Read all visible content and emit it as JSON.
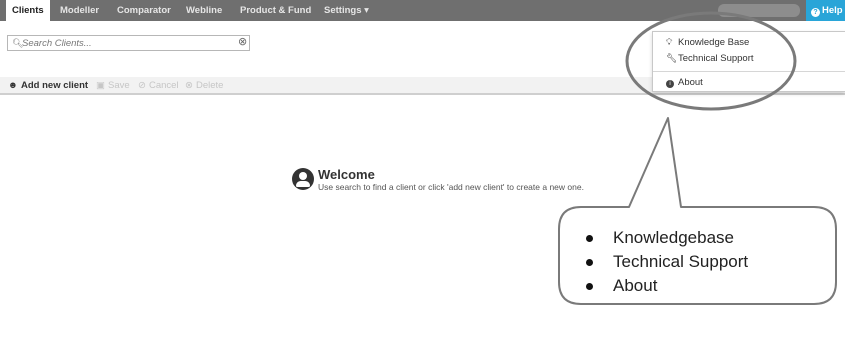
{
  "nav": {
    "tabs": [
      {
        "label": "Clients",
        "active": true
      },
      {
        "label": "Modeller"
      },
      {
        "label": "Comparator"
      },
      {
        "label": "Webline"
      },
      {
        "label": "Product & Fund"
      },
      {
        "label": "Settings ▾"
      }
    ],
    "help_label": "Help",
    "help_color": "#29a5d8"
  },
  "search": {
    "placeholder": "Search Clients...",
    "icon": "search-icon",
    "clear_icon": "clear-icon"
  },
  "toolbar": {
    "add_label": "Add new client",
    "save_label": "Save",
    "cancel_label": "Cancel",
    "delete_label": "Delete"
  },
  "welcome": {
    "title": "Welcome",
    "text": "Use search to find a client or click 'add new client' to create a new one."
  },
  "help_menu": {
    "items": [
      {
        "label": "Knowledge Base",
        "icon": "lightbulb-icon"
      },
      {
        "label": "Technical Support",
        "icon": "wrench-icon"
      },
      {
        "label": "About",
        "icon": "info-icon"
      }
    ]
  },
  "callout": {
    "items": [
      "Knowledgebase",
      "Technical Support",
      "About"
    ],
    "stroke_color": "#7a7a7a"
  }
}
